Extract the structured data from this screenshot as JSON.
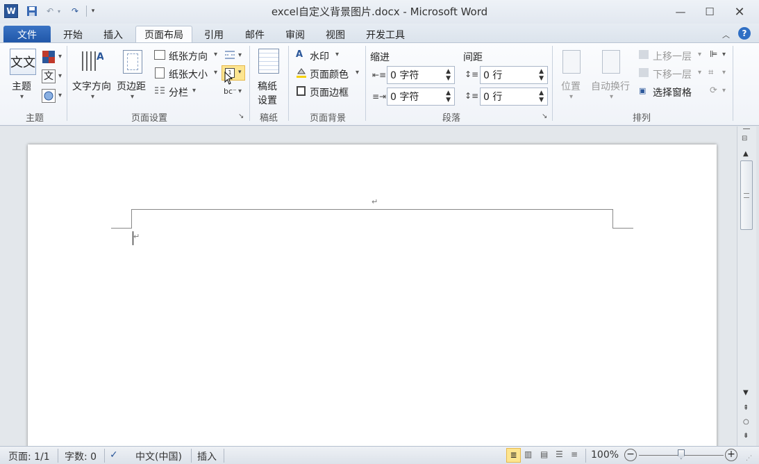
{
  "window": {
    "title": "excel自定义背景图片.docx - Microsoft Word"
  },
  "tabs": [
    "文件",
    "开始",
    "插入",
    "页面布局",
    "引用",
    "邮件",
    "审阅",
    "视图",
    "开发工具"
  ],
  "ribbon": {
    "themes": {
      "button": "主题",
      "group": "主题"
    },
    "page_setup": {
      "text_direction": "文字方向",
      "margins": "页边距",
      "orientation": "纸张方向",
      "size": "纸张大小",
      "columns": "分栏",
      "group": "页面设置"
    },
    "manuscript": {
      "button_line1": "稿纸",
      "button_line2": "设置",
      "group": "稿纸"
    },
    "page_background": {
      "watermark": "水印",
      "page_color": "页面颜色",
      "page_borders": "页面边框",
      "group": "页面背景"
    },
    "paragraph": {
      "indent_label": "缩进",
      "spacing_label": "间距",
      "indent_left": "0 字符",
      "indent_right": "0 字符",
      "spacing_before": "0 行",
      "spacing_after": "0 行",
      "group": "段落"
    },
    "arrange": {
      "position": "位置",
      "wrap_text": "自动换行",
      "bring_forward": "上移一层",
      "send_backward": "下移一层",
      "selection_pane": "选择窗格",
      "group": "排列"
    }
  },
  "statusbar": {
    "page": "页面: 1/1",
    "words": "字数: 0",
    "language": "中文(中国)",
    "mode": "插入",
    "zoom": "100%"
  }
}
